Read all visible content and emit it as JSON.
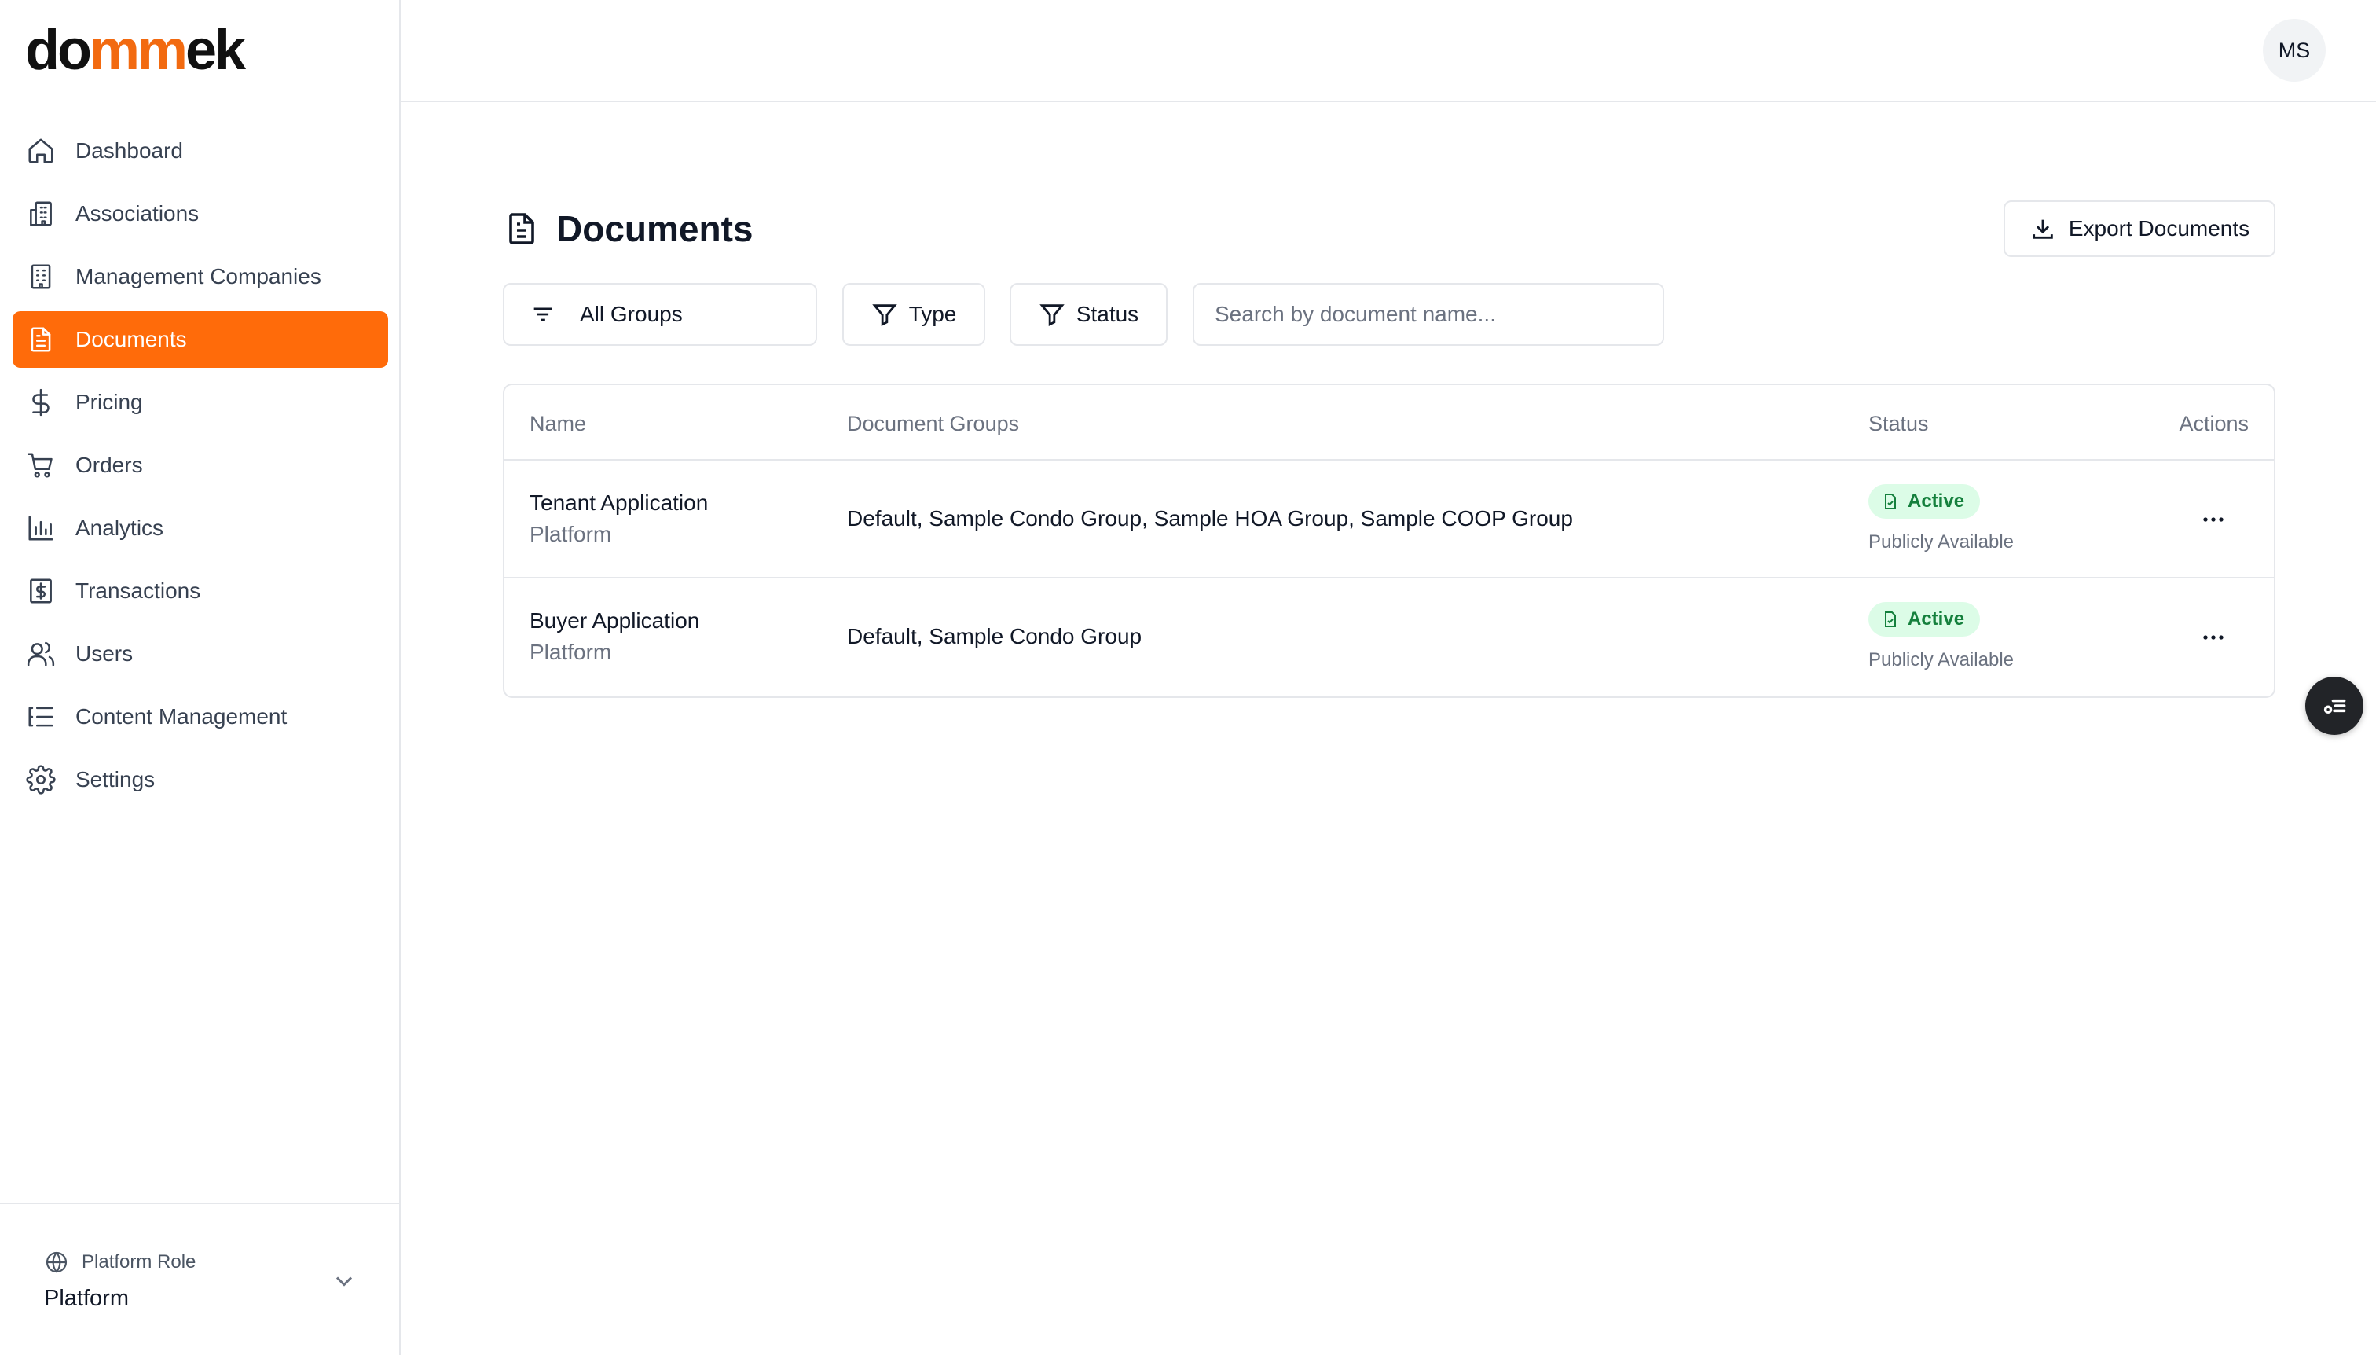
{
  "brand": {
    "logo_prefix": "do",
    "logo_accent": "mm",
    "logo_suffix": "ek",
    "accent_color": "#f26a10",
    "active_nav_color": "#ff6b0a"
  },
  "sidebar": {
    "items": [
      {
        "label": "Dashboard",
        "icon": "home-icon",
        "active": false
      },
      {
        "label": "Associations",
        "icon": "building-icon",
        "active": false
      },
      {
        "label": "Management Companies",
        "icon": "office-building-icon",
        "active": false
      },
      {
        "label": "Documents",
        "icon": "document-icon",
        "active": true
      },
      {
        "label": "Pricing",
        "icon": "dollar-icon",
        "active": false
      },
      {
        "label": "Orders",
        "icon": "cart-icon",
        "active": false
      },
      {
        "label": "Analytics",
        "icon": "bar-chart-icon",
        "active": false
      },
      {
        "label": "Transactions",
        "icon": "receipt-dollar-icon",
        "active": false
      },
      {
        "label": "Users",
        "icon": "users-icon",
        "active": false
      },
      {
        "label": "Content Management",
        "icon": "list-tree-icon",
        "active": false
      },
      {
        "label": "Settings",
        "icon": "gear-icon",
        "active": false
      }
    ],
    "footer": {
      "role_label": "Platform Role",
      "role_value": "Platform",
      "icon": "globe-icon"
    }
  },
  "topbar": {
    "avatar_initials": "MS"
  },
  "page": {
    "title": "Documents",
    "export_label": "Export Documents",
    "filters": {
      "groups_label": "All Groups",
      "type_label": "Type",
      "status_label": "Status"
    },
    "search": {
      "placeholder": "Search by document name...",
      "value": ""
    }
  },
  "table": {
    "columns": {
      "name": "Name",
      "groups": "Document Groups",
      "status": "Status",
      "actions": "Actions"
    },
    "rows": [
      {
        "name": "Tenant Application",
        "source": "Platform",
        "groups": "Default, Sample Condo Group, Sample HOA Group, Sample COOP Group",
        "status": "Active",
        "availability": "Publicly Available"
      },
      {
        "name": "Buyer Application",
        "source": "Platform",
        "groups": "Default, Sample Condo Group",
        "status": "Active",
        "availability": "Publicly Available"
      }
    ]
  },
  "colors": {
    "status_active_bg": "#dcfce7",
    "status_active_text": "#15803d"
  }
}
